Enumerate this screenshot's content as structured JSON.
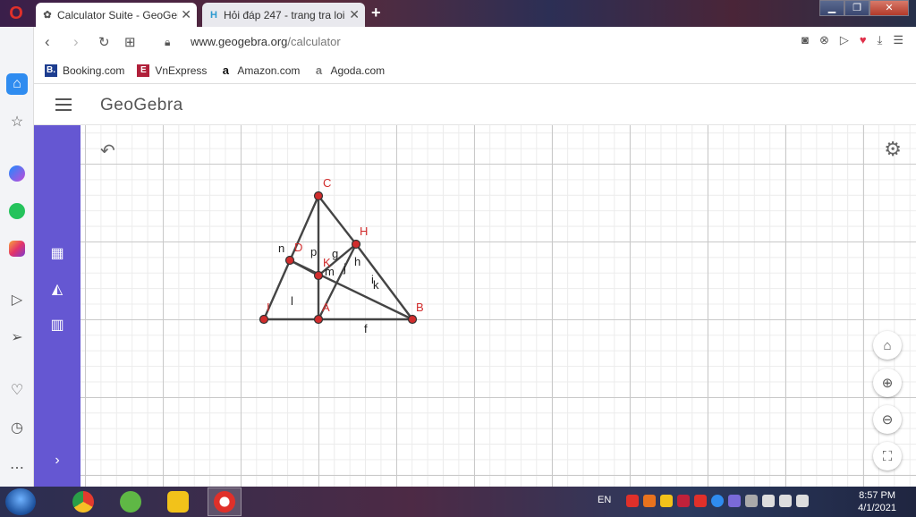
{
  "browser": {
    "tabs": [
      {
        "title": "Calculator Suite - GeoGebra",
        "close": "✕",
        "icon": "geogebra-icon"
      },
      {
        "title": "Hỏi đáp 247 - trang tra loi",
        "close": "✕",
        "icon": "hoidap-icon"
      }
    ],
    "new_tab": "+",
    "window_buttons": {
      "minimize": "▁",
      "maximize": "❐",
      "close": "✕"
    },
    "nav": {
      "back": "‹",
      "forward": "›",
      "reload": "↻",
      "tabs": "⊞"
    },
    "url": {
      "host": "www.geogebra.org",
      "path": "/calculator"
    },
    "bookmarks": [
      {
        "label": "Booking.com",
        "icon": "B.",
        "color": "#1d3d8f"
      },
      {
        "label": "VnExpress",
        "icon": "E",
        "color": "#b0203a"
      },
      {
        "label": "Amazon.com",
        "icon": "a",
        "color": "#111111"
      },
      {
        "label": "Agoda.com",
        "icon": "a",
        "color": "#777777"
      }
    ]
  },
  "geogebra": {
    "logo": "GeoGebra",
    "accent_color": "#6557d2",
    "points": [
      {
        "label": "C"
      },
      {
        "label": "H"
      },
      {
        "label": "D"
      },
      {
        "label": "K"
      },
      {
        "label": "I"
      },
      {
        "label": "A"
      },
      {
        "label": "B"
      }
    ],
    "segment_labels": [
      "n",
      "p",
      "g",
      "h",
      "m",
      "j",
      "i",
      "k",
      "l",
      "f"
    ]
  },
  "taskbar": {
    "language": "EN",
    "time": "8:57 PM",
    "date": "4/1/2021"
  }
}
